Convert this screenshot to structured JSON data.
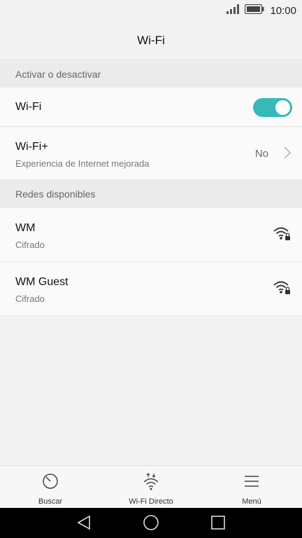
{
  "status_bar": {
    "time": "10:00",
    "icons": [
      "signal-icon",
      "battery-icon"
    ]
  },
  "header": {
    "title": "Wi-Fi"
  },
  "sections": {
    "toggle_section": "Activar o desactivar",
    "networks_section": "Redes disponibles"
  },
  "wifi_toggle": {
    "label": "Wi-Fi",
    "state": "on",
    "accent": "#38b9b8"
  },
  "wifi_plus": {
    "label": "Wi-Fi+",
    "description": "Experiencia de Internet mejorada",
    "value": "No"
  },
  "networks": [
    {
      "name": "WM",
      "security": "Cifrado",
      "icon": "wifi-lock-icon"
    },
    {
      "name": "WM Guest",
      "security": "Cifrado",
      "icon": "wifi-lock-icon"
    }
  ],
  "bottom_nav": {
    "items": [
      {
        "label": "Buscar",
        "icon": "scan-icon"
      },
      {
        "label": "Wi-Fi Directo",
        "icon": "wifi-direct-icon"
      },
      {
        "label": "Menú",
        "icon": "menu-icon"
      }
    ]
  },
  "system_nav": [
    "back-icon",
    "home-icon",
    "recents-icon"
  ]
}
